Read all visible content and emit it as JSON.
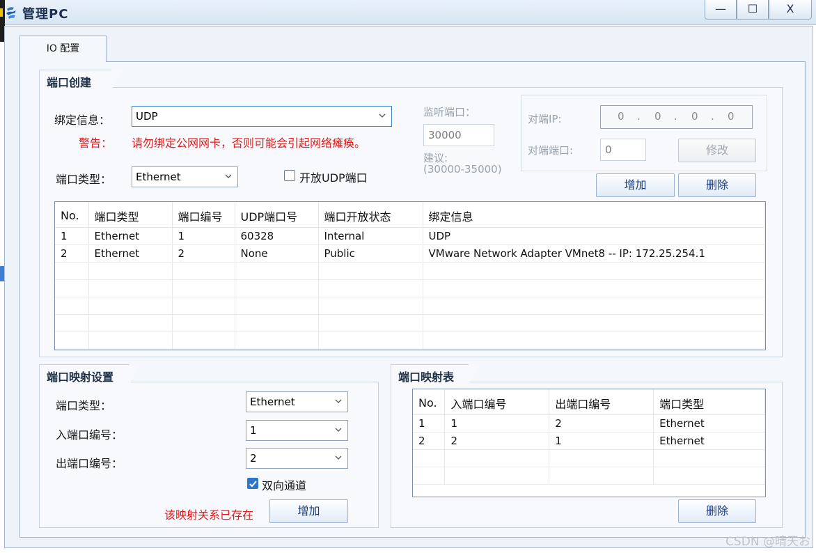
{
  "window": {
    "title": "管理PC",
    "minimize_label": "—",
    "maximize_label": "☐",
    "close_label": "X"
  },
  "tabs": [
    {
      "label": "IO 配置"
    }
  ],
  "port_create": {
    "section_title": "端口创建",
    "binding_label": "绑定信息：",
    "binding_value": "UDP",
    "warning_label": "警告：",
    "warning_text": "请勿绑定公网网卡，否则可能会引起网络瘫痪。",
    "port_type_label": "端口类型：",
    "port_type_value": "Ethernet",
    "open_udp_label": "开放UDP端口",
    "open_udp_checked": false,
    "listen_port_label": "监听端口：",
    "listen_port_value": "30000",
    "suggest_label": "建议:",
    "suggest_range": "(30000-35000)",
    "peer_ip_label": "对端IP:",
    "peer_ip_octets": [
      "0",
      "0",
      "0",
      "0"
    ],
    "peer_ip_dot": ".",
    "peer_port_label": "对端端口:",
    "peer_port_value": "0",
    "modify_button": "修改",
    "add_button": "增加",
    "delete_button": "删除",
    "table": {
      "columns": [
        "No.",
        "端口类型",
        "端口编号",
        "UDP端口号",
        "端口开放状态",
        "绑定信息"
      ],
      "rows": [
        [
          "1",
          "Ethernet",
          "1",
          "60328",
          "Internal",
          "UDP"
        ],
        [
          "2",
          "Ethernet",
          "2",
          "None",
          "Public",
          "VMware Network Adapter VMnet8 -- IP: 172.25.254.1"
        ]
      ]
    }
  },
  "port_mapping": {
    "section_title": "端口映射设置",
    "port_type_label": "端口类型：",
    "port_type_value": "Ethernet",
    "in_port_label": "入端口编号：",
    "in_port_value": "1",
    "out_port_label": "出端口编号：",
    "out_port_value": "2",
    "bidirectional_label": "双向通道",
    "bidirectional_checked": true,
    "exists_warning": "该映射关系已存在",
    "add_button": "增加"
  },
  "mapping_table": {
    "section_title": "端口映射表",
    "columns": [
      "No.",
      "入端口编号",
      "出端口编号",
      "端口类型"
    ],
    "rows": [
      [
        "1",
        "1",
        "2",
        "Ethernet"
      ],
      [
        "2",
        "2",
        "1",
        "Ethernet"
      ]
    ],
    "delete_button": "删除"
  },
  "watermark": "CSDN @晴天お",
  "colors": {
    "warning": "#e11b1b",
    "accent": "#2f75c8",
    "button_text": "#1c3c7a"
  },
  "icons": [
    "app-icon",
    "minimize-icon",
    "maximize-icon",
    "close-icon",
    "chevron-down-icon",
    "checkmark-icon"
  ]
}
